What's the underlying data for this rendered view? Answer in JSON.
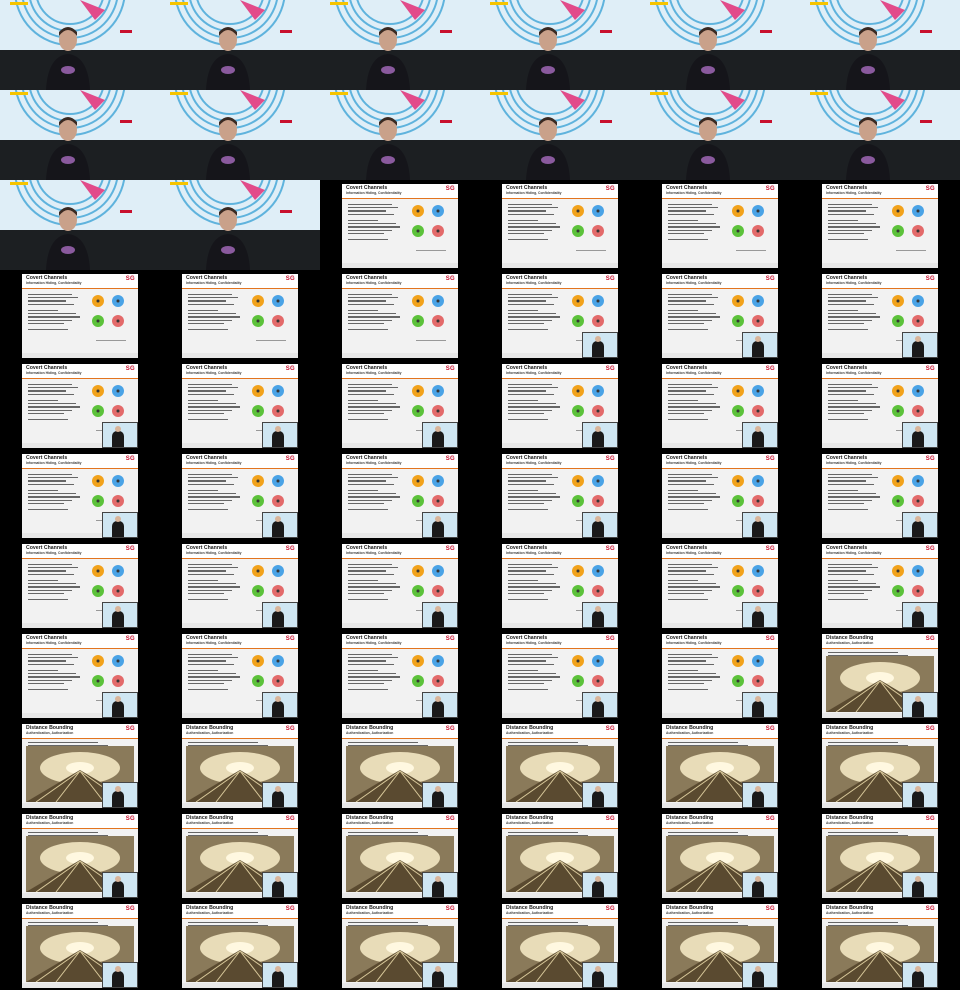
{
  "grid": {
    "columns": 6,
    "rows": 11
  },
  "speaker_frames": 14,
  "slides": {
    "covert": {
      "title": "Covert Channels",
      "subtitle": "Information Hiding, Confidentiality",
      "logo": "SG",
      "dot_colors": [
        "#f2a21b",
        "#4aa3e6",
        "#5cc23a",
        "#e36a6a"
      ]
    },
    "distance": {
      "title": "Distance Bounding",
      "subtitle": "Authentication, Authorization",
      "logo": "SG"
    }
  },
  "frames": [
    "speaker",
    "speaker",
    "speaker",
    "speaker",
    "speaker",
    "speaker",
    "speaker",
    "speaker",
    "speaker",
    "speaker",
    "speaker",
    "speaker",
    "speaker",
    "speaker",
    "covert",
    "covert",
    "covert",
    "covert",
    "covert",
    "covert",
    "covert",
    "covert-pip",
    "covert-pip",
    "covert-pip",
    "covert-pip",
    "covert-pip",
    "covert-pip",
    "covert-pip",
    "covert-pip",
    "covert-pip",
    "covert-pip",
    "covert-pip",
    "covert-pip",
    "covert-pip",
    "covert-pip",
    "covert-pip",
    "covert-pip",
    "covert-pip",
    "covert-pip",
    "covert-pip",
    "covert-pip",
    "covert-pip",
    "covert-pip",
    "covert-pip",
    "covert-pip",
    "covert-pip",
    "covert-pip",
    "distance-pip",
    "distance-pip",
    "distance-pip",
    "distance-pip",
    "distance-pip",
    "distance-pip",
    "distance-pip",
    "distance-pip",
    "distance-pip",
    "distance-pip",
    "distance-pip",
    "distance-pip",
    "distance-pip",
    "distance-pip",
    "distance-pip",
    "distance-pip",
    "distance-pip",
    "distance-pip",
    "distance-pip"
  ]
}
